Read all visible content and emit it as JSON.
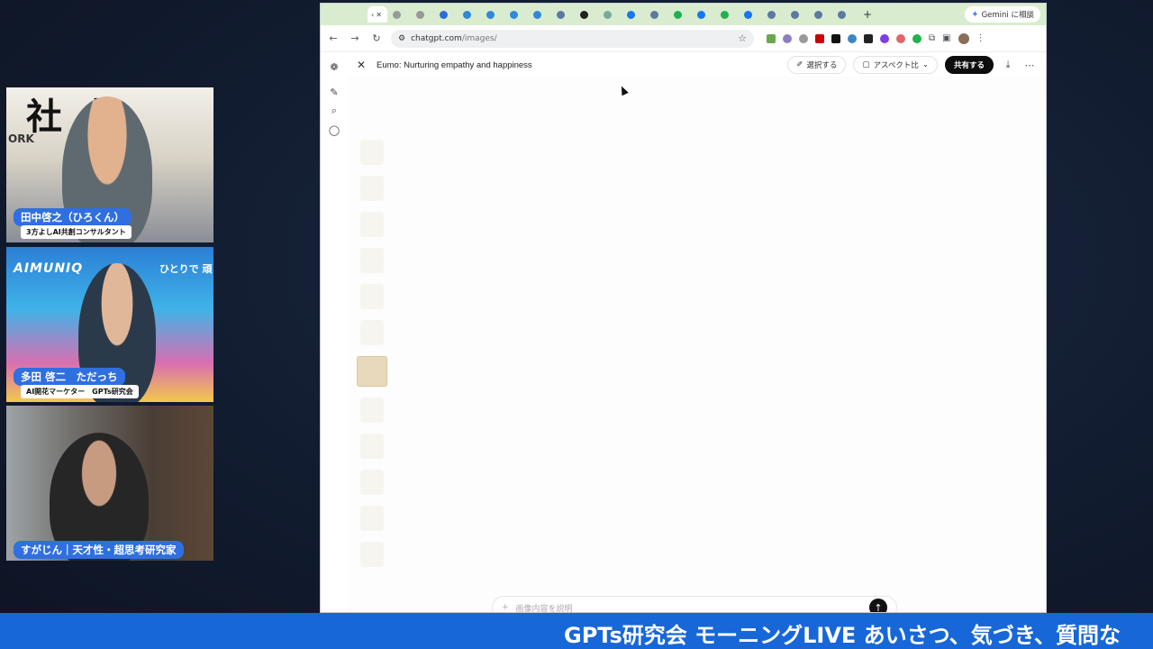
{
  "participants": [
    {
      "name": "田中啓之（ひろくん）",
      "title": "3方よしAI共創コンサルタント",
      "bg_big": "社 人",
      "bg_small": "ORK"
    },
    {
      "name": "多田 啓二　ただっち",
      "title": "AI開花マーケター　GPTs研究会",
      "bg_logo": "AIMUNIQ",
      "bg_right": "ひとりで 頑"
    },
    {
      "name": "すがじん｜天才性・超思考研究家"
    }
  ],
  "browser": {
    "url_host": "chatgpt.com",
    "url_path": "/images/",
    "gemini_label": "Gemini に相談",
    "tab_new": "+"
  },
  "app": {
    "doc_title": "Eumo: Nurturing empathy and happiness",
    "select_label": "選択する",
    "aspect_label": "アスペクト比",
    "share_label": "共有する",
    "prompt_placeholder": "画像内容を説明"
  },
  "ticker": {
    "text": "GPTs研究会 モーニングLIVE あいさつ、気づき、質問な"
  },
  "icons": [
    "close-icon",
    "edit-icon",
    "search-icon",
    "chat-icon",
    "back-icon",
    "forward-icon",
    "reload-icon",
    "star-icon",
    "download-icon",
    "more-icon",
    "send-icon",
    "plus-icon"
  ],
  "colors": {
    "accent": "#1767d8",
    "name_tag": "#2f6fe0",
    "tabstrip": "#d9ecd0",
    "share": "#0d0d0d"
  }
}
